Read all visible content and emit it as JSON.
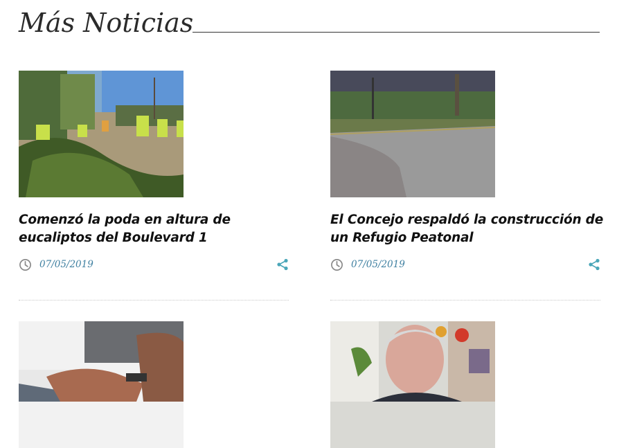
{
  "section": {
    "title": "Más Noticias"
  },
  "posts": [
    {
      "title": "Comenzó la poda en altura de eucaliptos del Boulevard 1",
      "date": "07/05/2019",
      "image_desc": "workers-pruning-eucalyptus"
    },
    {
      "title": "El Concejo respaldó la construcción de un Refugio Peatonal",
      "date": "07/05/2019",
      "image_desc": "street-intersection"
    },
    {
      "title": "",
      "date": "",
      "image_desc": "hand-on-phone-keypad"
    },
    {
      "title": "",
      "date": "",
      "image_desc": "man-portrait"
    }
  ],
  "icons": {
    "clock": "clock-icon",
    "share": "share-icon"
  },
  "colors": {
    "accent": "#3e7fa0",
    "share": "#4aa6b8",
    "text": "#111111"
  }
}
